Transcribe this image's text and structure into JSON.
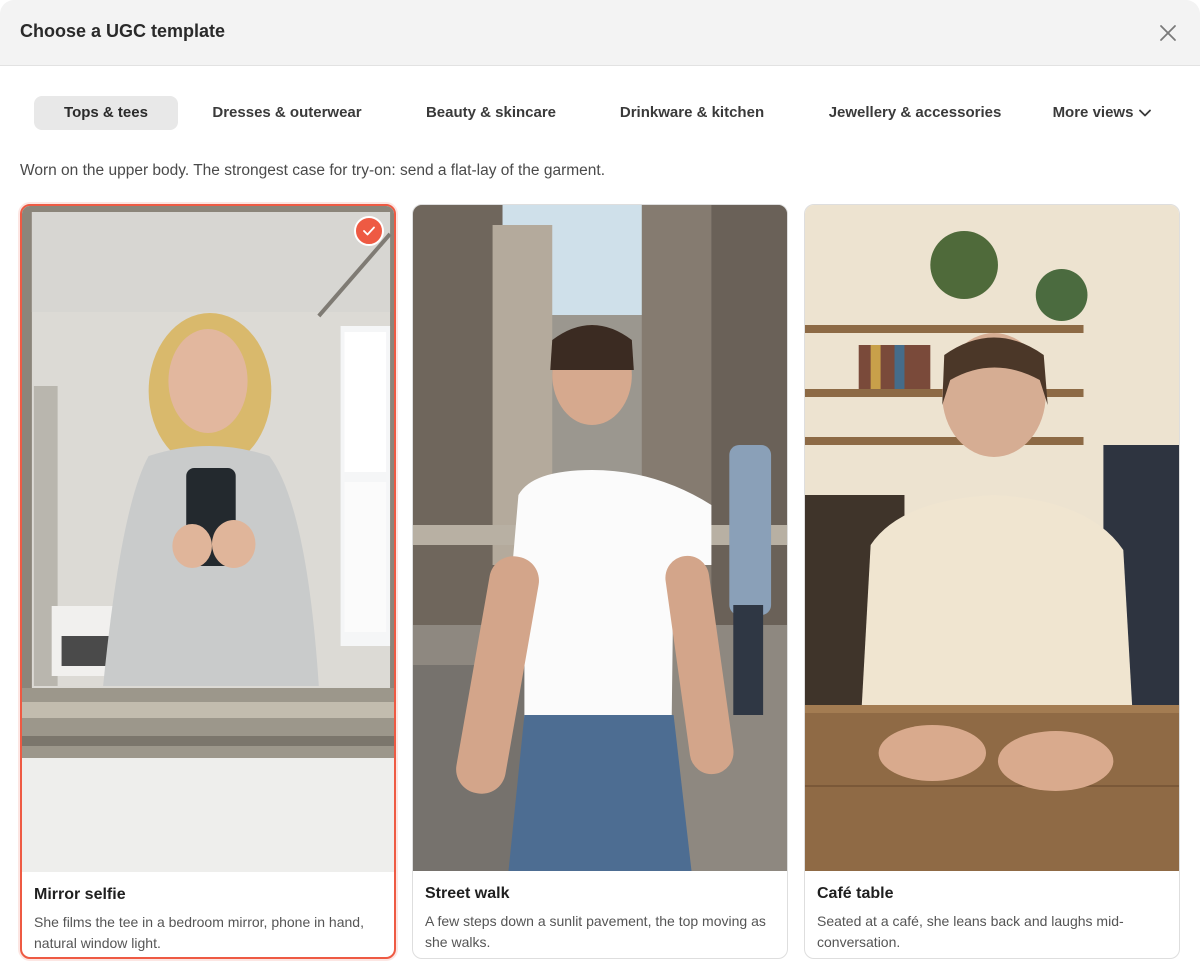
{
  "dialog": {
    "title": "Choose a UGC template",
    "close_icon": "close-icon"
  },
  "tabs": [
    {
      "label": "Tops & tees",
      "active": true
    },
    {
      "label": "Dresses & outerwear",
      "active": false
    },
    {
      "label": "Beauty & skincare",
      "active": false
    },
    {
      "label": "Drinkware & kitchen",
      "active": false
    },
    {
      "label": "Jewellery & accessories",
      "active": false
    },
    {
      "label": "More views",
      "active": false,
      "icon": "chevron-down-icon"
    }
  ],
  "category_description": "Worn on the upper body. The strongest case for try-on: send a flat-lay of the garment.",
  "templates": [
    {
      "title": "Mirror selfie",
      "description": "She films the tee in a bedroom mirror, phone in hand, natural window light.",
      "selected": true
    },
    {
      "title": "Street walk",
      "description": "A few steps down a sunlit pavement, the top moving as she walks.",
      "selected": false
    },
    {
      "title": "Café table",
      "description": "Seated at a café, she leans back and laughs mid-conversation.",
      "selected": false
    }
  ],
  "colors": {
    "accent": "#ee5a43",
    "header_bg": "#f3f3f3",
    "active_tab_bg": "#e8e8e8"
  },
  "selected_icon": "checkmark-icon"
}
